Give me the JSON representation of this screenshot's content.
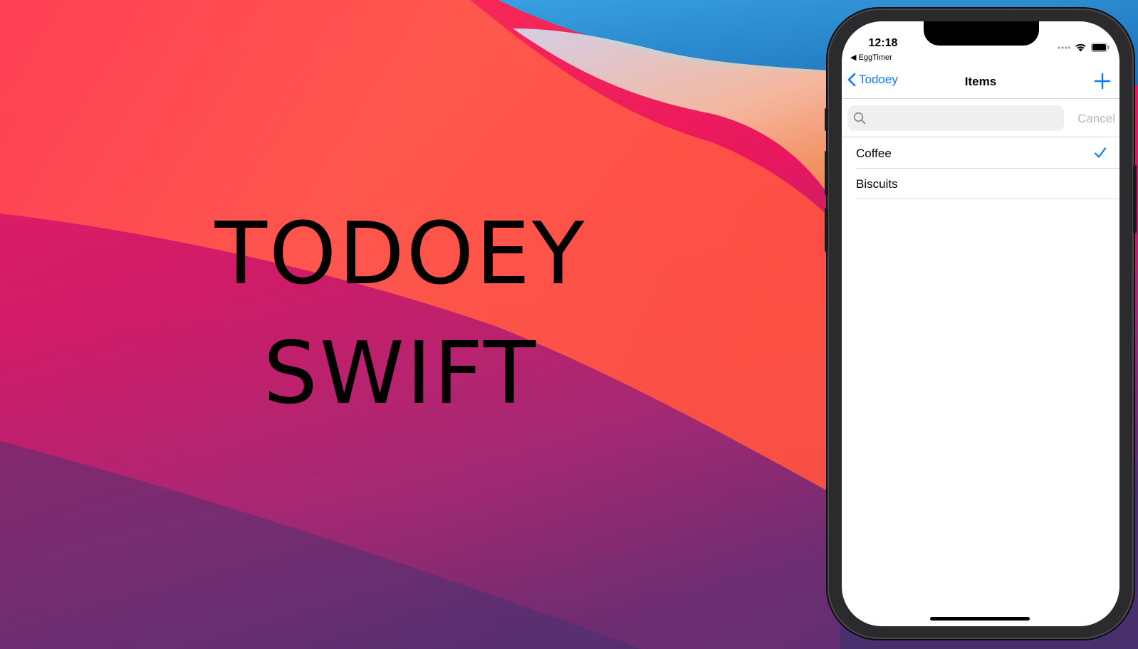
{
  "hero": {
    "line1": "TODOEY",
    "line2": "SWIFT"
  },
  "phone": {
    "status": {
      "time": "12:18",
      "back_app": "◀ EggTimer",
      "icons": [
        "signal-dots-icon",
        "wifi-icon",
        "battery-icon"
      ]
    },
    "nav": {
      "back_label": "Todoey",
      "title": "Items",
      "add_icon": "plus-icon"
    },
    "search": {
      "value": "",
      "placeholder": "",
      "cancel_label": "Cancel"
    },
    "items": [
      {
        "label": "Coffee",
        "checked": true
      },
      {
        "label": "Biscuits",
        "checked": false
      }
    ]
  },
  "colors": {
    "accent": "#0a7aff",
    "cancel_gray": "#b8b8bc",
    "separator": "#d8d8dc"
  }
}
